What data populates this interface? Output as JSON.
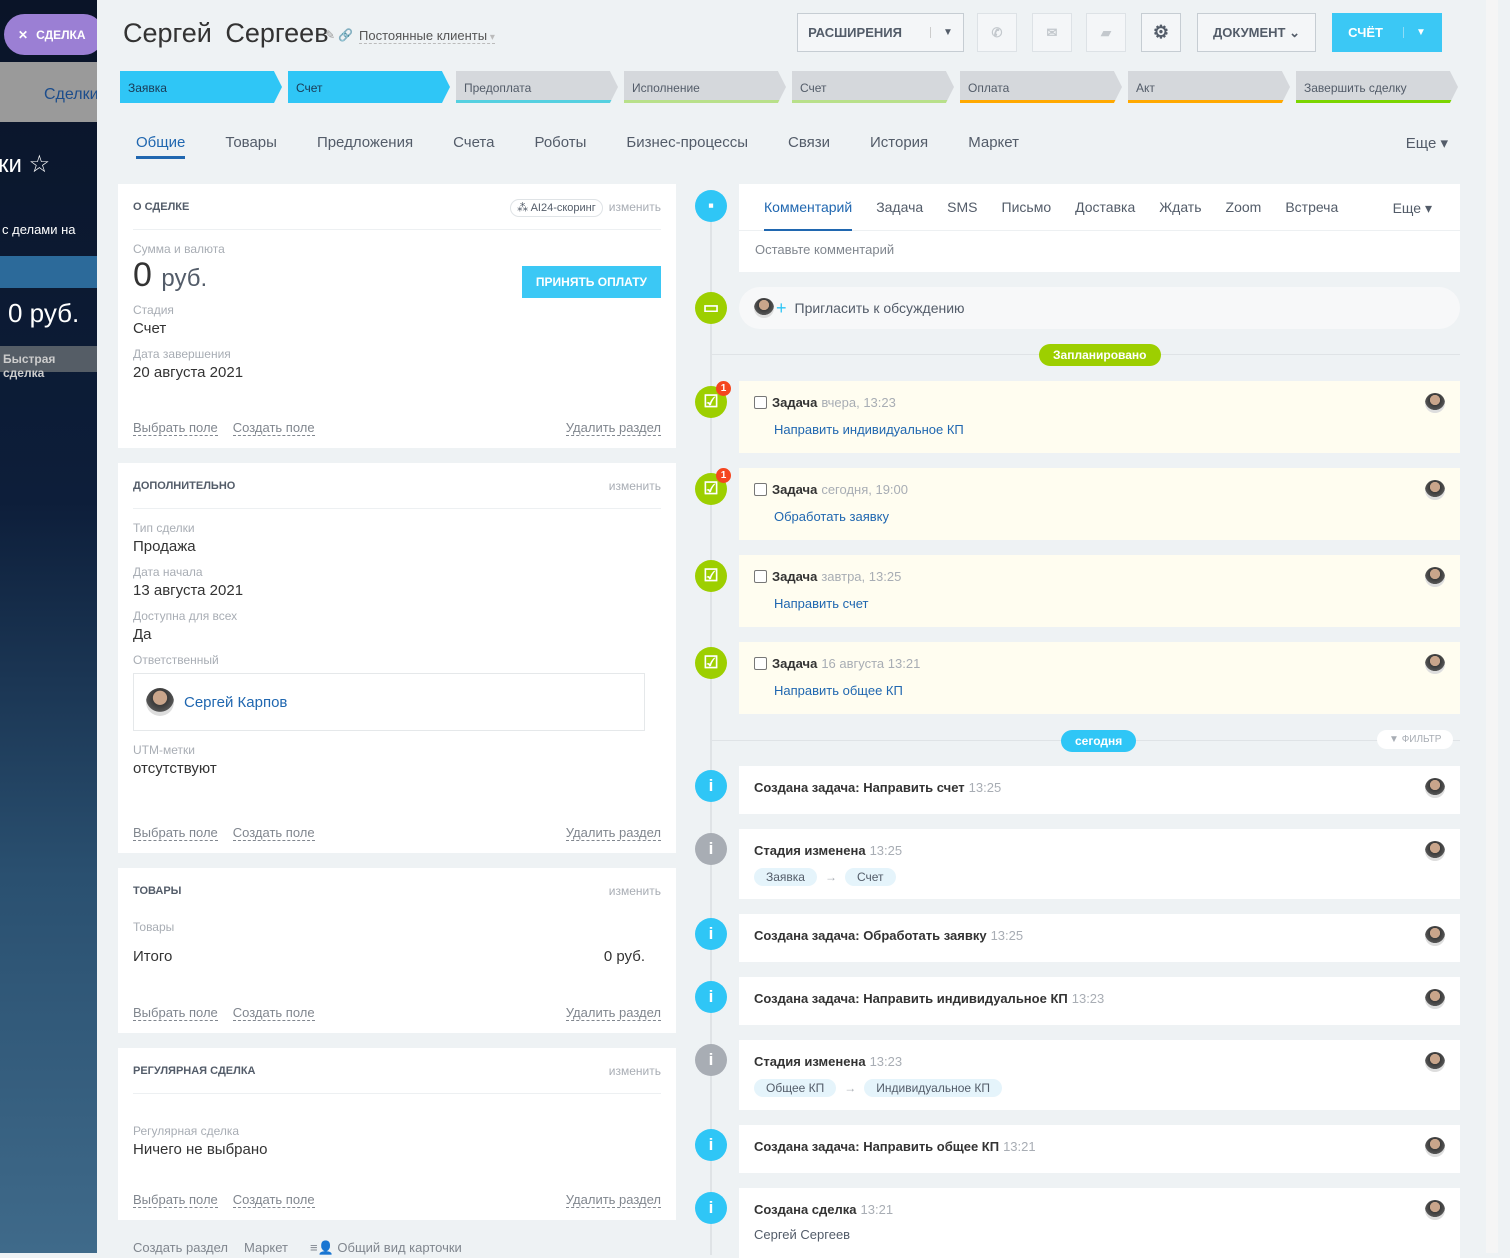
{
  "background": {
    "deal_pill": "СДЕЛКА",
    "tab": "Сделки",
    "title_part": "ки",
    "filter_text": "с делами на",
    "amount": "0 руб.",
    "quick_deal": "Быстрая сделка"
  },
  "header": {
    "title": "Сергей  Сергеев",
    "category": "Постоянные клиенты",
    "extensions": "РАСШИРЕНИЯ",
    "document": "ДОКУМЕНТ",
    "invoice": "СЧЁТ"
  },
  "stages": [
    {
      "label": "Заявка",
      "color": "#2fc6f6"
    },
    {
      "label": "Счет",
      "color": "#2fc6f6"
    },
    {
      "label": "Предоплата",
      "color": "#55d0e0"
    },
    {
      "label": "Исполнение",
      "color": "#b8e08a"
    },
    {
      "label": "Счет",
      "color": "#b8e08a"
    },
    {
      "label": "Оплата",
      "color": "#ffa900"
    },
    {
      "label": "Акт",
      "color": "#ffa900"
    },
    {
      "label": "Завершить сделку",
      "color": "#7bd500"
    }
  ],
  "tabs": [
    "Общие",
    "Товары",
    "Предложения",
    "Счета",
    "Роботы",
    "Бизнес-процессы",
    "Связи",
    "История",
    "Маркет"
  ],
  "tabs_more": "Еще",
  "common": {
    "edit": "изменить",
    "select_field": "Выбрать поле",
    "create_field": "Создать поле",
    "delete_section": "Удалить раздел"
  },
  "about": {
    "title": "О СДЕЛКЕ",
    "scoring": "AI24-скоринг",
    "sum_label": "Сумма и валюта",
    "sum": "0",
    "currency": "руб.",
    "accept": "ПРИНЯТЬ ОПЛАТУ",
    "stage_label": "Стадия",
    "stage": "Счет",
    "close_label": "Дата завершения",
    "close": "20 августа 2021"
  },
  "extra": {
    "title": "ДОПОЛНИТЕЛЬНО",
    "type_label": "Тип сделки",
    "type": "Продажа",
    "start_label": "Дата начала",
    "start": "13 августа 2021",
    "avail_label": "Доступна для всех",
    "avail": "Да",
    "resp_label": "Ответственный",
    "resp": "Сергей Карпов",
    "utm_label": "UTM-метки",
    "utm": "отсутствуют"
  },
  "goods": {
    "title": "ТОВАРЫ",
    "label": "Товары",
    "total_label": "Итого",
    "total": "0 руб."
  },
  "regular": {
    "title": "РЕГУЛЯРНАЯ СДЕЛКА",
    "label": "Регулярная сделка",
    "value": "Ничего не выбрано"
  },
  "footer": {
    "create_section": "Создать раздел",
    "market": "Маркет",
    "common_view": "Общий вид карточки"
  },
  "composer": {
    "tabs": [
      "Комментарий",
      "Задача",
      "SMS",
      "Письмо",
      "Доставка",
      "Ждать",
      "Zoom",
      "Встреча"
    ],
    "more": "Еще",
    "placeholder": "Оставьте комментарий"
  },
  "invite": "Пригласить к обсуждению",
  "planned": "Запланировано",
  "today": "сегодня",
  "filter": "ФИЛЬТР",
  "tasks": [
    {
      "title": "Задача",
      "time": "вчера, 13:23",
      "link": "Направить индивидуальное КП",
      "badge": "1"
    },
    {
      "title": "Задача",
      "time": "сегодня, 19:00",
      "link": "Обработать заявку",
      "badge": "1"
    },
    {
      "title": "Задача",
      "time": "завтра, 13:25",
      "link": "Направить счет"
    },
    {
      "title": "Задача",
      "time": "16 августа 13:21",
      "link": "Направить общее КП"
    }
  ],
  "history": [
    {
      "title": "Создана задача: Направить счет",
      "time": "13:25"
    },
    {
      "title": "Стадия изменена",
      "time": "13:25",
      "from": "Заявка",
      "to": "Счет"
    },
    {
      "title": "Создана задача: Обработать заявку",
      "time": "13:25"
    },
    {
      "title": "Создана задача: Направить индивидуальное КП",
      "time": "13:23"
    },
    {
      "title": "Стадия изменена",
      "time": "13:23",
      "from": "Общее КП",
      "to": "Индивидуальное КП"
    },
    {
      "title": "Создана задача: Направить общее КП",
      "time": "13:21"
    },
    {
      "title": "Создана сделка",
      "time": "13:21",
      "sub": "Сергей Сергеев"
    }
  ]
}
